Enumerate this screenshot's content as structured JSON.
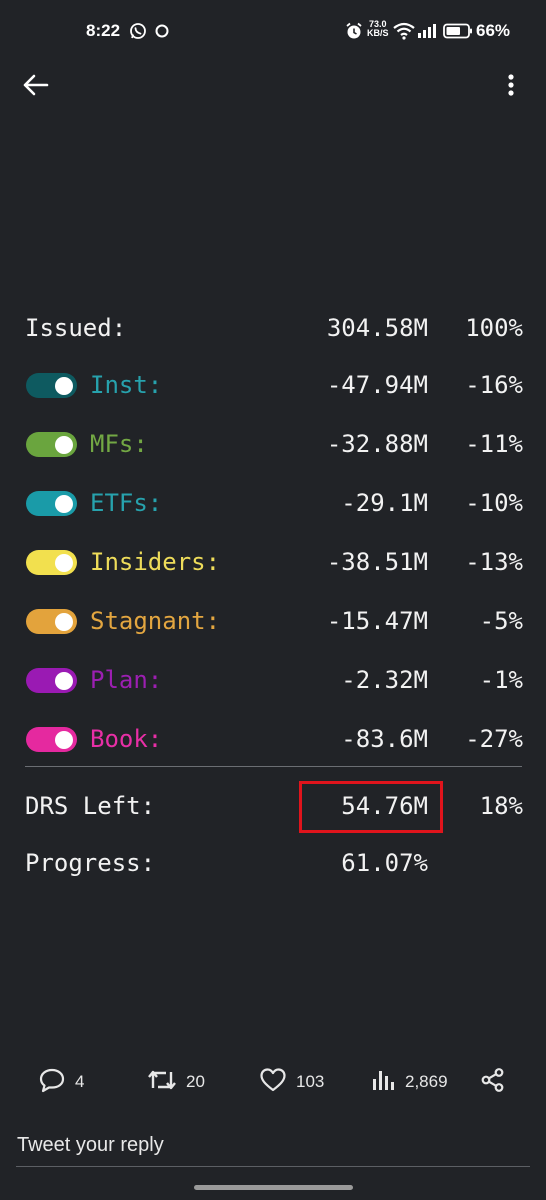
{
  "status_bar": {
    "time": "8:22",
    "net_speed_value": "73.0",
    "net_speed_unit": "KB/S",
    "battery_percent": "66%",
    "icons": [
      "whatsapp-icon",
      "circle-notification-icon",
      "alarm-icon",
      "wifi-icon",
      "signal-icon",
      "battery-icon"
    ]
  },
  "nav": {
    "icons": [
      "back-arrow-icon",
      "more-vertical-icon"
    ]
  },
  "stats": {
    "issued": {
      "label": "Issued:",
      "value": "304.58M",
      "pct": "100%"
    },
    "rows": [
      {
        "label": "Inst:",
        "value": "-47.94M",
        "pct": "-16%",
        "color": "#27a2ad",
        "toggle_color": "#0e5a60",
        "enabled": true
      },
      {
        "label": "MFs:",
        "value": "-32.88M",
        "pct": "-11%",
        "color": "#73a844",
        "toggle_color": "#6aa53e",
        "enabled": true
      },
      {
        "label": "ETFs:",
        "value": "-29.1M",
        "pct": "-10%",
        "color": "#27a2ad",
        "toggle_color": "#1a9ba8",
        "enabled": true
      },
      {
        "label": "Insiders:",
        "value": "-38.51M",
        "pct": "-13%",
        "color": "#eedc5a",
        "toggle_color": "#f2e04e",
        "enabled": true
      },
      {
        "label": "Stagnant:",
        "value": "-15.47M",
        "pct": "-5%",
        "color": "#e3a640",
        "toggle_color": "#e3a33c",
        "enabled": true
      },
      {
        "label": "Plan:",
        "value": "-2.32M",
        "pct": "-1%",
        "color": "#9c1fb2",
        "toggle_color": "#9a1ab3",
        "enabled": true
      },
      {
        "label": "Book:",
        "value": "-83.6M",
        "pct": "-27%",
        "color": "#e82fa6",
        "toggle_color": "#e5299f",
        "enabled": true
      }
    ],
    "drs_left": {
      "label": "DRS Left:",
      "value": "54.76M",
      "pct": "18%"
    },
    "progress": {
      "label": "Progress:",
      "value": "61.07%"
    },
    "highlight_color": "#e0141c"
  },
  "tweet_actions": {
    "replies": "4",
    "retweets": "20",
    "likes": "103",
    "views": "2,869",
    "icons": [
      "reply-icon",
      "retweet-icon",
      "like-icon",
      "views-icon",
      "share-icon"
    ]
  },
  "reply": {
    "placeholder": "Tweet your reply"
  }
}
